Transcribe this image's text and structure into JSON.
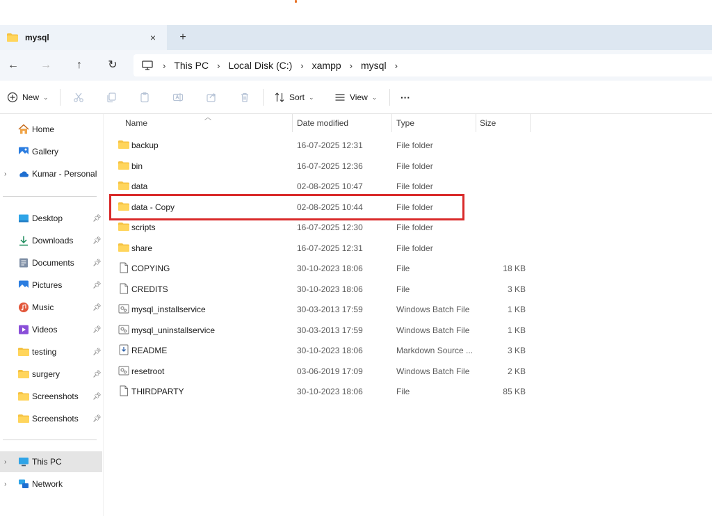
{
  "tab": {
    "title": "mysql",
    "close": "×",
    "new": "+"
  },
  "nav_buttons": {
    "back": "←",
    "forward": "→",
    "up": "↑",
    "refresh": "↻"
  },
  "breadcrumbs": [
    "This PC",
    "Local Disk (C:)",
    "xampp",
    "mysql"
  ],
  "breadcrumb_sep": "›",
  "commands": {
    "new": "New",
    "sort": "Sort",
    "view": "View",
    "more": "···"
  },
  "sidebar": {
    "top": [
      {
        "label": "Home",
        "icon": "home-icon"
      },
      {
        "label": "Gallery",
        "icon": "gallery-icon"
      },
      {
        "label": "Kumar - Personal",
        "icon": "cloud-icon"
      }
    ],
    "quick": [
      {
        "label": "Desktop",
        "icon": "desktop-icon"
      },
      {
        "label": "Downloads",
        "icon": "download-icon"
      },
      {
        "label": "Documents",
        "icon": "documents-icon"
      },
      {
        "label": "Pictures",
        "icon": "pictures-icon"
      },
      {
        "label": "Music",
        "icon": "music-icon"
      },
      {
        "label": "Videos",
        "icon": "videos-icon"
      },
      {
        "label": "testing",
        "icon": "folder-icon"
      },
      {
        "label": "surgery",
        "icon": "folder-icon"
      },
      {
        "label": "Screenshots",
        "icon": "folder-icon"
      },
      {
        "label": "Screenshots",
        "icon": "folder-icon"
      }
    ],
    "bottom": [
      {
        "label": "This PC",
        "icon": "pc-icon"
      },
      {
        "label": "Network",
        "icon": "network-icon"
      }
    ]
  },
  "columns": {
    "name": "Name",
    "date": "Date modified",
    "type": "Type",
    "size": "Size"
  },
  "files": [
    {
      "name": "backup",
      "date": "16-07-2025 12:31",
      "type": "File folder",
      "size": "",
      "kind": "folder"
    },
    {
      "name": "bin",
      "date": "16-07-2025 12:36",
      "type": "File folder",
      "size": "",
      "kind": "folder"
    },
    {
      "name": "data",
      "date": "02-08-2025 10:47",
      "type": "File folder",
      "size": "",
      "kind": "folder"
    },
    {
      "name": "data - Copy",
      "date": "02-08-2025 10:44",
      "type": "File folder",
      "size": "",
      "kind": "folder"
    },
    {
      "name": "scripts",
      "date": "16-07-2025 12:30",
      "type": "File folder",
      "size": "",
      "kind": "folder"
    },
    {
      "name": "share",
      "date": "16-07-2025 12:31",
      "type": "File folder",
      "size": "",
      "kind": "folder"
    },
    {
      "name": "COPYING",
      "date": "30-10-2023 18:06",
      "type": "File",
      "size": "18 KB",
      "kind": "file"
    },
    {
      "name": "CREDITS",
      "date": "30-10-2023 18:06",
      "type": "File",
      "size": "3 KB",
      "kind": "file"
    },
    {
      "name": "mysql_installservice",
      "date": "30-03-2013 17:59",
      "type": "Windows Batch File",
      "size": "1 KB",
      "kind": "batch"
    },
    {
      "name": "mysql_uninstallservice",
      "date": "30-03-2013 17:59",
      "type": "Windows Batch File",
      "size": "1 KB",
      "kind": "batch"
    },
    {
      "name": "README",
      "date": "30-10-2023 18:06",
      "type": "Markdown Source ...",
      "size": "3 KB",
      "kind": "markdown"
    },
    {
      "name": "resetroot",
      "date": "03-06-2019 17:09",
      "type": "Windows Batch File",
      "size": "2 KB",
      "kind": "batch"
    },
    {
      "name": "THIRDPARTY",
      "date": "30-10-2023 18:06",
      "type": "File",
      "size": "85 KB",
      "kind": "file"
    }
  ],
  "colors": {
    "highlight": "#d92a2a",
    "folder": "#f5c242",
    "accent": "#0067c0"
  }
}
